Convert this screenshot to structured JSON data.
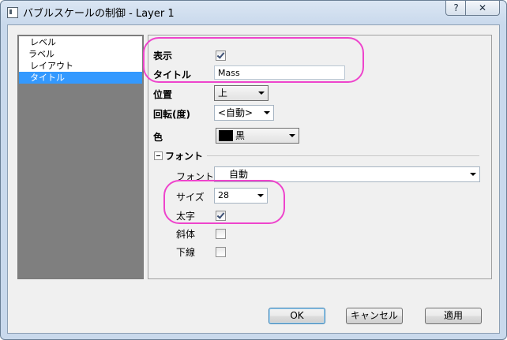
{
  "window": {
    "title": "バブルスケールの制御 - Layer 1",
    "help_label": "?",
    "close_label": "✕"
  },
  "tree": {
    "items": [
      {
        "label": "レベル",
        "selected": false
      },
      {
        "label": "ラベル",
        "selected": false
      },
      {
        "label": "レイアウト",
        "selected": false
      },
      {
        "label": "タイトル",
        "selected": true
      }
    ]
  },
  "form": {
    "show_label": "表示",
    "show_checked": true,
    "title_label": "タイトル",
    "title_value": "Mass",
    "position_label": "位置",
    "position_value": "上",
    "rotation_label": "回転(度)",
    "rotation_value": "<自動>",
    "color_label": "色",
    "color_value": "黒",
    "color_hex": "#000000"
  },
  "font_group": {
    "header": "フォント",
    "font_label": "フォント",
    "font_value": "自動",
    "size_label": "サイズ",
    "size_value": "28",
    "bold_label": "太字",
    "bold_checked": true,
    "italic_label": "斜体",
    "italic_checked": false,
    "underline_label": "下線",
    "underline_checked": false
  },
  "buttons": {
    "ok": "OK",
    "cancel": "キャンセル",
    "apply": "適用"
  },
  "colors": {
    "highlight": "#ee44cc",
    "selection": "#3399ff"
  }
}
